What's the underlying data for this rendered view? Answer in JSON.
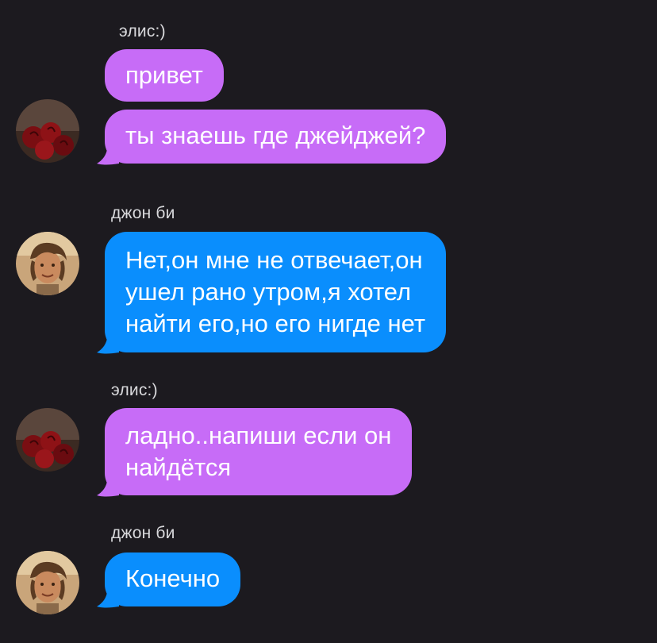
{
  "colors": {
    "background": "#1c1a1f",
    "purple_bubble": "#c76cf7",
    "blue_bubble": "#0a8efd",
    "sender_text": "#d9d9dc"
  },
  "messages": [
    {
      "sender": "элис:)",
      "text": "привет",
      "avatar": "roses-avatar"
    },
    {
      "sender": "",
      "text": "ты знаешь где джейджей?",
      "avatar": "roses-avatar"
    },
    {
      "sender": "джон би",
      "lines": [
        "Нет,он мне не отвечает,он",
        "ушел рано утром,я хотел",
        "найти его,но его нигде нет"
      ],
      "avatar": "guy-avatar"
    },
    {
      "sender": "элис:)",
      "lines": [
        "ладно..напиши если он",
        "найдётся"
      ],
      "avatar": "roses-avatar"
    },
    {
      "sender": "джон би",
      "text": "Конечно",
      "avatar": "guy-avatar"
    }
  ]
}
